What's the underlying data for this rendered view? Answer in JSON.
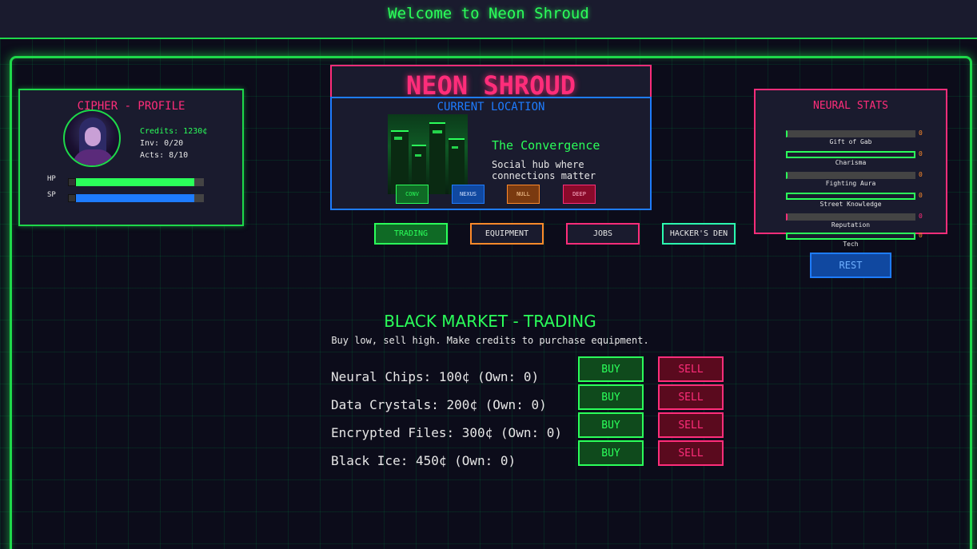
{
  "header": {
    "title": "Welcome to Neon Shroud"
  },
  "game_title": "NEON SHROUD",
  "profile": {
    "title": "CIPHER - PROFILE",
    "credits": "Credits: 1230¢",
    "inventory": "Inv: 0/20",
    "actions": "Acts: 8/10",
    "hp_label": "HP",
    "sp_label": "SP",
    "hp_fraction": 0.93,
    "sp_fraction": 0.93
  },
  "location": {
    "title": "CURRENT LOCATION",
    "name": "The Convergence",
    "description": "Social hub where connections matter",
    "travel": [
      {
        "label": "CONV"
      },
      {
        "label": "NEXUS"
      },
      {
        "label": "NULL"
      },
      {
        "label": "DEEP"
      }
    ]
  },
  "nav": {
    "trading": "TRADING",
    "equipment": "EQUIPMENT",
    "jobs": "JOBS",
    "hackers_den": "HACKER'S DEN"
  },
  "neural_stats": {
    "title": "NEURAL STATS",
    "stats": [
      {
        "name": "Gift of Gab",
        "value": "0"
      },
      {
        "name": "Charisma",
        "value": "0"
      },
      {
        "name": "Fighting Aura",
        "value": "0"
      },
      {
        "name": "Street Knowledge",
        "value": "0"
      },
      {
        "name": "Reputation",
        "value": "0"
      },
      {
        "name": "Tech",
        "value": "0"
      }
    ],
    "rest_label": "REST"
  },
  "market": {
    "title": "BLACK MARKET - TRADING",
    "subtitle": "Buy low, sell high. Make credits to purchase equipment.",
    "items": [
      {
        "text": "Neural Chips: 100¢ (Own: 0)"
      },
      {
        "text": "Data Crystals: 200¢ (Own: 0)"
      },
      {
        "text": "Encrypted Files: 300¢ (Own: 0)"
      },
      {
        "text": "Black Ice: 450¢ (Own: 0)"
      }
    ],
    "buy_label": "BUY",
    "sell_label": "SELL"
  },
  "colors": {
    "accent_green": "#2bff5a",
    "accent_pink": "#ff2d7a",
    "accent_blue": "#1e7cff",
    "accent_orange": "#ff8a2a",
    "panel_bg": "#1a1b2e",
    "page_bg": "#0c0c1a"
  }
}
